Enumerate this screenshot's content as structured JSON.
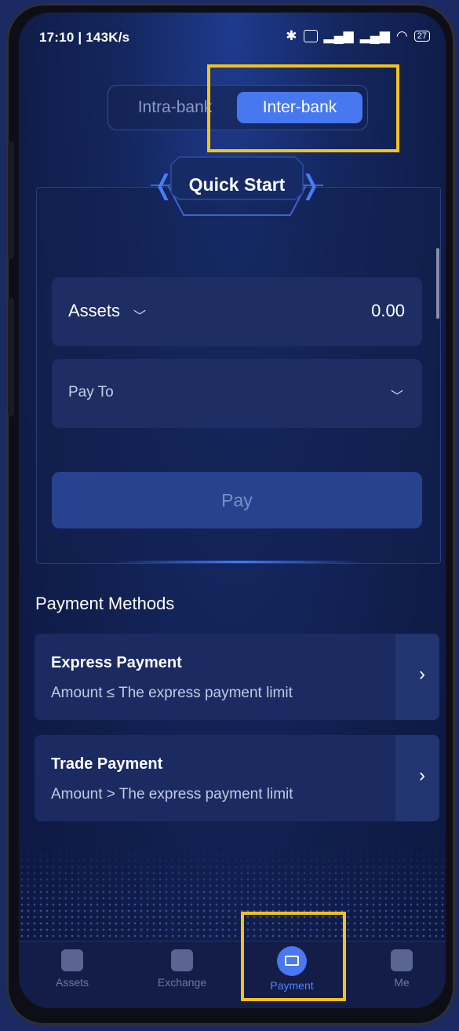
{
  "status_bar": {
    "left_text": "17:10 | 143K/s",
    "right_icons": [
      "bluetooth-icon",
      "vpn-icon",
      "signal-icon",
      "signal-icon",
      "wifi-icon",
      "battery-icon"
    ],
    "battery": "27"
  },
  "segmented": {
    "options": [
      "Intra-bank",
      "Inter-bank"
    ],
    "selected": "Inter-bank"
  },
  "quick_start": {
    "title": "Quick Start",
    "assets_label": "Assets",
    "assets_value": "0.00",
    "pay_to_label": "Pay To",
    "pay_button": "Pay"
  },
  "payment_methods": {
    "title": "Payment Methods",
    "items": [
      {
        "title": "Express Payment",
        "subtitle": "Amount ≤ The express payment limit"
      },
      {
        "title": "Trade Payment",
        "subtitle": "Amount > The express payment limit"
      }
    ]
  },
  "tabs": [
    {
      "label": "Assets",
      "icon": "wallet-icon"
    },
    {
      "label": "Exchange",
      "icon": "exchange-icon"
    },
    {
      "label": "Payment",
      "icon": "payment-icon",
      "active": true
    },
    {
      "label": "Me",
      "icon": "user-icon"
    }
  ],
  "colors": {
    "accent": "#4778f0",
    "highlight_box": "#f2c319",
    "background": "#101d4a"
  }
}
